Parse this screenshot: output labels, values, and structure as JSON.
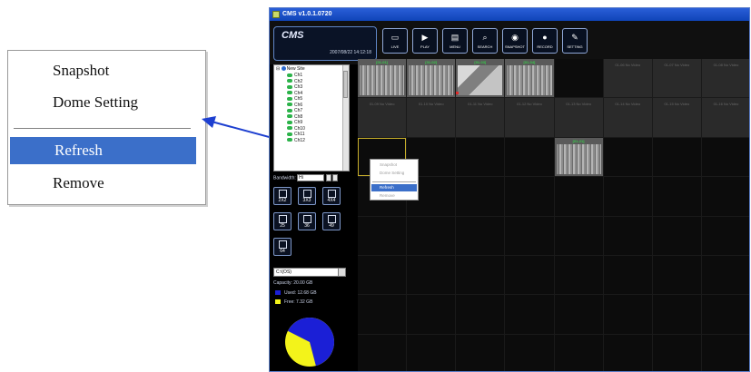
{
  "context_menu": {
    "items": [
      {
        "label": "Snapshot"
      },
      {
        "label": "Dome Setting"
      },
      {
        "label": "Refresh",
        "selected": true
      },
      {
        "label": "Remove"
      }
    ]
  },
  "window": {
    "title": "CMS v1.0.1.0720",
    "logo": "CMS",
    "datetime": "2007/08/22 14:12:18",
    "toolbar": [
      {
        "label": "LIVE",
        "icon": "monitor-icon"
      },
      {
        "label": "PLAY",
        "icon": "play-icon"
      },
      {
        "label": "MENU",
        "icon": "menu-icon"
      },
      {
        "label": "SEARCH",
        "icon": "search-icon"
      },
      {
        "label": "SNAPSHOT",
        "icon": "camera-icon"
      },
      {
        "label": "RECORD",
        "icon": "record-icon"
      },
      {
        "label": "SETTING",
        "icon": "wrench-icon"
      }
    ]
  },
  "tree": {
    "root": "New Site",
    "channels": [
      "Ch1",
      "Ch2",
      "Ch3",
      "Ch4",
      "Ch5",
      "Ch6",
      "Ch7",
      "Ch8",
      "Ch9",
      "Ch10",
      "Ch11",
      "Ch12"
    ]
  },
  "bandwidth": {
    "label": "Bandwidth:",
    "value": "Hi"
  },
  "layouts": [
    {
      "label": "2X2"
    },
    {
      "label": "3X3"
    },
    {
      "label": "4X4"
    },
    {
      "label": "25"
    },
    {
      "label": "36"
    },
    {
      "label": "49"
    },
    {
      "label": "64"
    }
  ],
  "storage": {
    "drive": "C:\\(OS)",
    "capacity": "Capacity: 20.00 GB",
    "used": "Used: 12.68 GB",
    "free": "Free: 7.32 GB",
    "used_color": "#1b1fd6",
    "free_color": "#f3f31a",
    "used_fraction": 0.634
  },
  "grid": {
    "row1": [
      {
        "type": "cam",
        "tag": "[01-01]"
      },
      {
        "type": "cam",
        "tag": "[01-02]"
      },
      {
        "type": "cam2",
        "tag": "[01-03]"
      },
      {
        "type": "cam",
        "tag": "[01-04]"
      },
      {
        "type": "empty"
      },
      {
        "type": "nv",
        "text": "01-06 No Video"
      },
      {
        "type": "nv",
        "text": "01-07 No Video"
      },
      {
        "type": "nv",
        "text": "01-08 No Video"
      }
    ],
    "row2": [
      "01-09 No Video",
      "01-10 No Video",
      "01-11 No Video",
      "01-12 No Video",
      "01-13 No Video",
      "01-14 No Video",
      "01-15 No Video",
      "01-16 No Video"
    ],
    "row3_cam_tag": "[01-21]"
  },
  "mini_menu": {
    "items": [
      "Snapshot",
      "Dome Setting",
      "Refresh",
      "Remove"
    ]
  }
}
